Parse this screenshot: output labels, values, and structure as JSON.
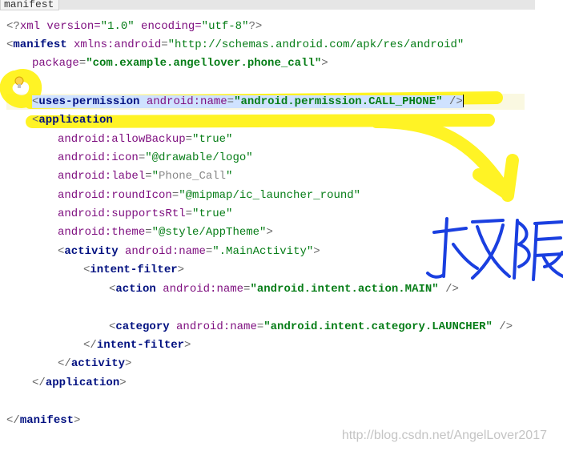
{
  "tab": {
    "label": "manifest"
  },
  "code": {
    "l1": {
      "p1": "<?",
      "t1": "xml version=",
      "v1": "\"1.0\"",
      "t2": " encoding=",
      "v2": "\"utf-8\"",
      "p2": "?>"
    },
    "l2": {
      "p1": "<",
      "t": "manifest",
      "a1": " xmlns:android",
      "eq1": "=",
      "v1": "\"http://schemas.android.com/apk/res/android\""
    },
    "l3": {
      "a": "package",
      "eq": "=",
      "v": "\"com.example.angellover.phone_call\"",
      "p": ">"
    },
    "l5": {
      "p1": "<",
      "t": "uses-permission",
      "a": " android:name",
      "eq": "=",
      "v": "\"android.permission.CALL_PHONE\"",
      "p2": " />"
    },
    "l6": {
      "p1": "<",
      "t": "application"
    },
    "l7": {
      "a": "android:allowBackup",
      "eq": "=",
      "v": "\"true\""
    },
    "l8": {
      "a": "android:icon",
      "eq": "=",
      "v": "\"@drawable/logo\""
    },
    "l9": {
      "a": "android:label",
      "eq": "=",
      "q": "\"",
      "v": "Phone_Call",
      "q2": "\""
    },
    "l10": {
      "a": "android:roundIcon",
      "eq": "=",
      "v": "\"@mipmap/ic_launcher_round\""
    },
    "l11": {
      "a": "android:supportsRtl",
      "eq": "=",
      "v": "\"true\""
    },
    "l12": {
      "a": "android:theme",
      "eq": "=",
      "v": "\"@style/AppTheme\"",
      "p": ">"
    },
    "l13": {
      "p1": "<",
      "t": "activity",
      "a": " android:name",
      "eq": "=",
      "v": "\".MainActivity\"",
      "p2": ">"
    },
    "l14": {
      "p1": "<",
      "t": "intent-filter",
      "p2": ">"
    },
    "l15": {
      "p1": "<",
      "t": "action",
      "a": " android:name",
      "eq": "=",
      "v": "\"android.intent.action.MAIN\"",
      "p2": " />"
    },
    "l17": {
      "p1": "<",
      "t": "category",
      "a": " android:name",
      "eq": "=",
      "v": "\"android.intent.category.LAUNCHER\"",
      "p2": " />"
    },
    "l18": {
      "p1": "</",
      "t": "intent-filter",
      "p2": ">"
    },
    "l19": {
      "p1": "</",
      "t": "activity",
      "p2": ">"
    },
    "l20": {
      "p1": "</",
      "t": "application",
      "p2": ">"
    },
    "l22": {
      "p1": "</",
      "t": "manifest",
      "p2": ">"
    }
  },
  "annotation": {
    "text": "权限"
  },
  "watermark": {
    "text": "http://blog.csdn.net/AngelLover2017"
  }
}
